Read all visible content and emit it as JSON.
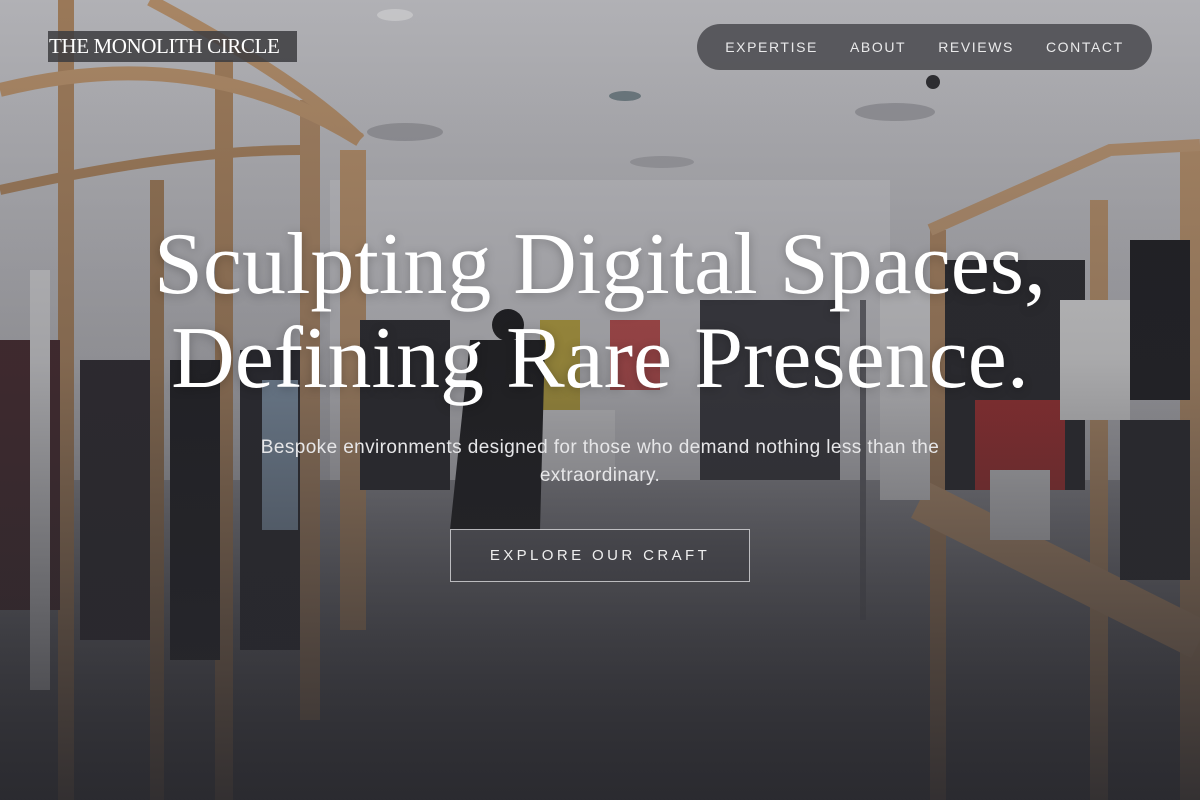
{
  "header": {
    "logo_text": "THE MONOLITH CIRCLE",
    "nav": [
      {
        "label": "EXPERTISE"
      },
      {
        "label": "ABOUT"
      },
      {
        "label": "REVIEWS"
      },
      {
        "label": "CONTACT"
      }
    ]
  },
  "hero": {
    "title_line1": "Sculpting Digital Spaces,",
    "title_line2": "Defining Rare Presence.",
    "subtitle": "Bespoke environments designed for those who demand nothing less than the extraordinary.",
    "cta_label": "EXPLORE OUR CRAFT",
    "background_image": "boutique-clothing-store-interior"
  },
  "colors": {
    "text": "#ffffff",
    "nav_background": "#46464a",
    "overlay": "#28282d"
  }
}
